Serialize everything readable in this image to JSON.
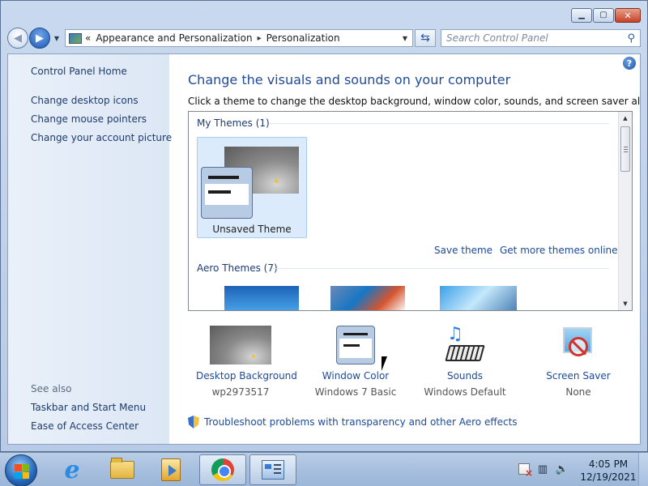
{
  "window": {
    "caption": {
      "minimize": "▁",
      "maximize": "▢",
      "close": "✕"
    }
  },
  "navbar": {
    "breadcrumb": [
      "Appearance and Personalization",
      "Personalization"
    ],
    "breadcrumb_prefix": "«",
    "separator": "▸",
    "search_placeholder": "Search Control Panel"
  },
  "sidebar": {
    "home": "Control Panel Home",
    "links": [
      "Change desktop icons",
      "Change mouse pointers",
      "Change your account picture"
    ],
    "see_also_heading": "See also",
    "see_also": [
      "Taskbar and Start Menu",
      "Ease of Access Center"
    ]
  },
  "main": {
    "title": "Change the visuals and sounds on your computer",
    "description": "Click a theme to change the desktop background, window color, sounds, and screen saver all at once.",
    "my_themes_label": "My Themes (1)",
    "selected_theme": "Unsaved Theme",
    "save_theme": "Save theme",
    "get_more": "Get more themes online",
    "aero_themes_label": "Aero Themes (7)",
    "bottom": [
      {
        "link": "Desktop Background",
        "value": "wp2973517",
        "icon": "desktop-background-icon"
      },
      {
        "link": "Window Color",
        "value": "Windows 7 Basic",
        "icon": "window-color-icon"
      },
      {
        "link": "Sounds",
        "value": "Windows Default",
        "icon": "sounds-icon"
      },
      {
        "link": "Screen Saver",
        "value": "None",
        "icon": "screen-saver-icon"
      }
    ],
    "troubleshoot": "Troubleshoot problems with transparency and other Aero effects"
  },
  "taskbar": {
    "apps": [
      "internet-explorer",
      "windows-explorer",
      "windows-media-player",
      "google-chrome",
      "control-panel"
    ],
    "time": "4:05 PM",
    "date": "12/19/2021"
  },
  "colors": {
    "link": "#1e4a9a",
    "title": "#1e4a9a",
    "selected_tile": "#dcebfc"
  }
}
